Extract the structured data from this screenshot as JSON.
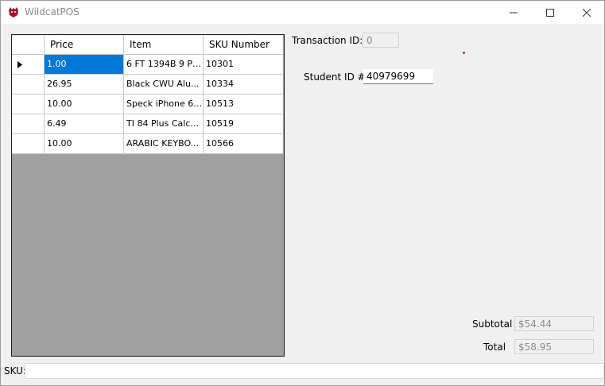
{
  "window": {
    "title": "WildcatPOS"
  },
  "grid": {
    "columns": [
      "Price",
      "Item",
      "SKU Number"
    ],
    "rows": [
      {
        "price": "1.00",
        "item": "6 FT 1394B 9 PI...",
        "sku": "10301"
      },
      {
        "price": "26.95",
        "item": "Black CWU Alu...",
        "sku": "10334"
      },
      {
        "price": "10.00",
        "item": "Speck iPhone 6 ...",
        "sku": "10513"
      },
      {
        "price": "6.49",
        "item": "TI 84 Plus Calcu...",
        "sku": "10519"
      },
      {
        "price": "10.00",
        "item": "ARABIC KEYBO...",
        "sku": "10566"
      }
    ]
  },
  "transaction": {
    "label": "Transaction ID:",
    "value": "0"
  },
  "student": {
    "label": "Student ID #",
    "value": "40979699"
  },
  "totals": {
    "subtotal_label": "Subtotal",
    "subtotal_value": "$54.44",
    "total_label": "Total",
    "total_value": "$58.95"
  },
  "sku": {
    "label": "SKU:",
    "value": ""
  },
  "colors": {
    "selection": "#0078d7",
    "grid_background": "#a0a0a0",
    "accent_dot": "#d22222"
  }
}
